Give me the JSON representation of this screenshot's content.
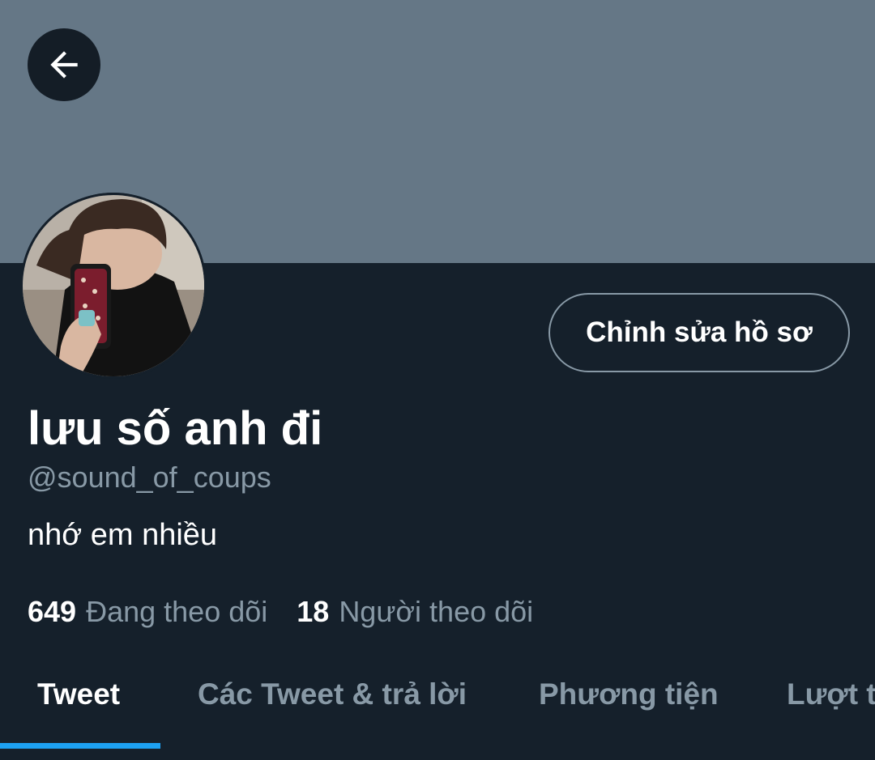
{
  "profile": {
    "display_name": "lưu số anh đi",
    "handle": "@sound_of_coups",
    "bio": "nhớ em nhiều",
    "edit_button_label": "Chỉnh sửa hồ sơ",
    "following_count": "649",
    "following_label": "Đang theo dõi",
    "followers_count": "18",
    "followers_label": "Người theo dõi"
  },
  "tabs": [
    {
      "label": "Tweet",
      "active": true
    },
    {
      "label": "Các Tweet & trả lời",
      "active": false
    },
    {
      "label": "Phương tiện",
      "active": false
    },
    {
      "label": "Lượt thích",
      "active": false
    }
  ],
  "icons": {
    "back": "arrow-left-icon"
  },
  "colors": {
    "background": "#15202b",
    "banner": "#657786",
    "secondary_text": "#8899a6",
    "accent": "#1da1f2"
  }
}
